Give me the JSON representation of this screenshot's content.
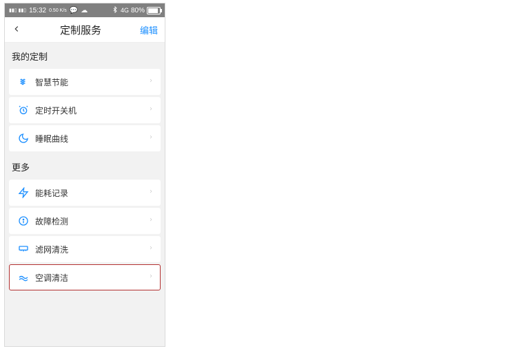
{
  "status": {
    "signal": "4G 4G",
    "time": "15:32",
    "speed": "0.50 K/s",
    "bt": "⚙",
    "net": "4G",
    "battery_pct": "80%"
  },
  "nav": {
    "title": "定制服务",
    "edit": "编辑"
  },
  "sections": {
    "my": {
      "header": "我的定制",
      "items": [
        {
          "icon": "energy-icon",
          "label": "智慧节能"
        },
        {
          "icon": "timer-icon",
          "label": "定时开关机"
        },
        {
          "icon": "sleep-icon",
          "label": "睡眠曲线"
        }
      ]
    },
    "more": {
      "header": "更多",
      "items": [
        {
          "icon": "bolt-icon",
          "label": "能耗记录"
        },
        {
          "icon": "diag-icon",
          "label": "故障检测"
        },
        {
          "icon": "filter-icon",
          "label": "滤网清洗"
        },
        {
          "icon": "clean-icon",
          "label": "空调清洁",
          "hl": true
        }
      ]
    }
  }
}
